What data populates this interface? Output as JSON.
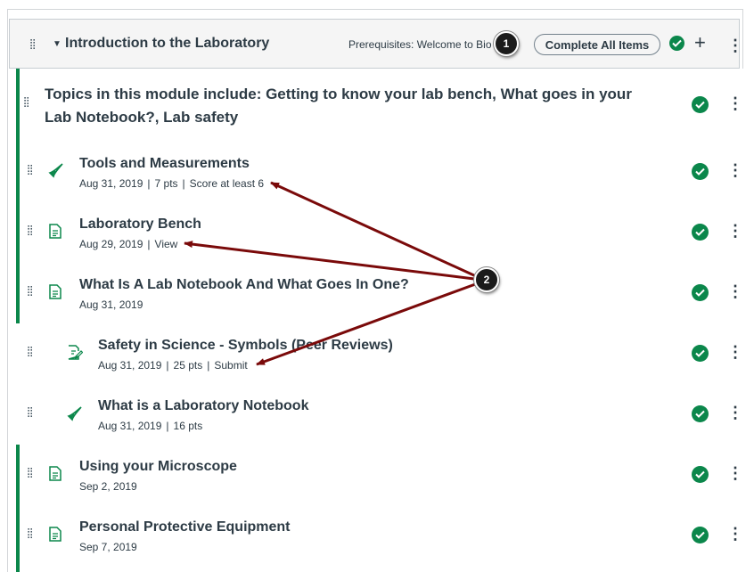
{
  "module": {
    "title": "Introduction to the Laboratory",
    "prerequisites": "Prerequisites: Welcome to Bio 1",
    "requirement_button": "Complete All Items",
    "add_icon": "plus-icon",
    "options_icon": "kebab-icon"
  },
  "subheader": "Topics in this module include: Getting to know your lab bench, What goes in your Lab Notebook?, Lab safety",
  "items": [
    {
      "type": "quiz",
      "icon": "rocket-icon",
      "title": "Tools and Measurements",
      "date": "Aug 31, 2019",
      "points": "7 pts",
      "requirement": "Score at least 6",
      "indent": 0
    },
    {
      "type": "page",
      "icon": "page-icon",
      "title": "Laboratory Bench",
      "date": "Aug 29, 2019",
      "requirement": "View",
      "indent": 0
    },
    {
      "type": "page",
      "icon": "page-icon",
      "title": "What Is A Lab Notebook And What Goes In One?",
      "date": "Aug 31, 2019",
      "indent": 0
    },
    {
      "type": "assignment",
      "icon": "assignment-icon",
      "title": "Safety in Science - Symbols (Peer Reviews)",
      "date": "Aug 31, 2019",
      "points": "25 pts",
      "requirement": "Submit",
      "indent": 1
    },
    {
      "type": "quiz",
      "icon": "rocket-icon",
      "title": "What is a Laboratory Notebook",
      "date": "Aug 31, 2019",
      "points": "16 pts",
      "indent": 1
    },
    {
      "type": "page",
      "icon": "page-icon",
      "title": "Using your Microscope",
      "date": "Sep 2, 2019",
      "indent": 0
    },
    {
      "type": "page",
      "icon": "page-icon",
      "title": "Personal Protective Equipment",
      "date": "Sep 7, 2019",
      "indent": 0
    }
  ],
  "callouts": {
    "one": "1",
    "two": "2"
  },
  "colors": {
    "published": "#0b874b",
    "arrow": "#7a0a0a",
    "text": "#2d3b45"
  }
}
